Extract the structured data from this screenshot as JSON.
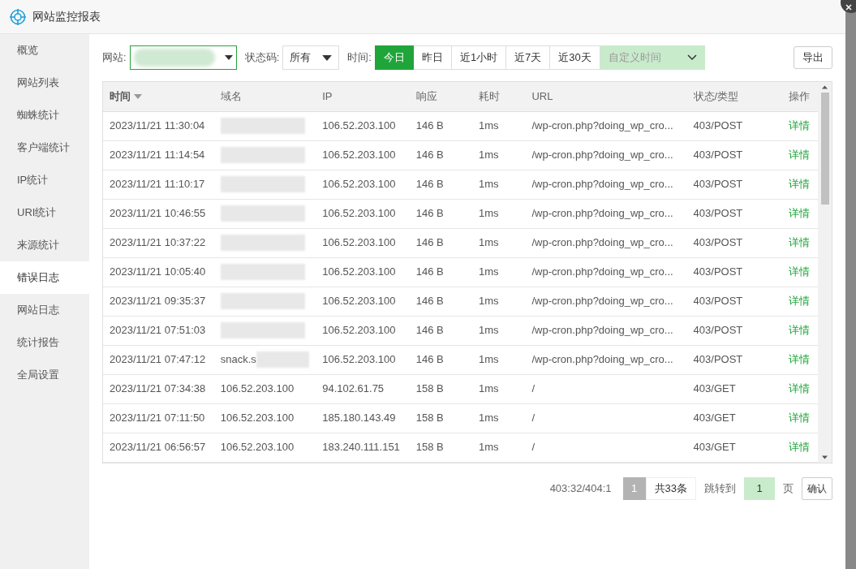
{
  "window": {
    "title": "网站监控报表"
  },
  "sidebar": {
    "items": [
      {
        "label": "概览",
        "selected": false
      },
      {
        "label": "网站列表",
        "selected": false
      },
      {
        "label": "蜘蛛统计",
        "selected": false
      },
      {
        "label": "客户端统计",
        "selected": false
      },
      {
        "label": "IP统计",
        "selected": false
      },
      {
        "label": "URI统计",
        "selected": false
      },
      {
        "label": "来源统计",
        "selected": false
      },
      {
        "label": "错误日志",
        "selected": true
      },
      {
        "label": "网站日志",
        "selected": false
      },
      {
        "label": "统计报告",
        "selected": false
      },
      {
        "label": "全局设置",
        "selected": false
      }
    ]
  },
  "filters": {
    "site_label": "网站:",
    "status_label": "状态码:",
    "status_value": "所有",
    "time_label": "时间:",
    "time_ranges": [
      {
        "label": "今日",
        "selected": true
      },
      {
        "label": "昨日",
        "selected": false
      },
      {
        "label": "近1小时",
        "selected": false
      },
      {
        "label": "近7天",
        "selected": false
      },
      {
        "label": "近30天",
        "selected": false
      }
    ],
    "custom_time_placeholder": "自定义时间",
    "export": "导出"
  },
  "table": {
    "columns": [
      "时间",
      "域名",
      "IP",
      "响应",
      "耗时",
      "URL",
      "状态/类型",
      "操作"
    ],
    "rows": [
      {
        "time": "2023/11/21 11:30:04",
        "domain": "",
        "ip": "106.52.203.100",
        "size": "146 B",
        "duration": "1ms",
        "url": "/wp-cron.php?doing_wp_cro...",
        "status": "403/POST",
        "action": "详情"
      },
      {
        "time": "2023/11/21 11:14:54",
        "domain": "",
        "ip": "106.52.203.100",
        "size": "146 B",
        "duration": "1ms",
        "url": "/wp-cron.php?doing_wp_cro...",
        "status": "403/POST",
        "action": "详情"
      },
      {
        "time": "2023/11/21 11:10:17",
        "domain": "",
        "ip": "106.52.203.100",
        "size": "146 B",
        "duration": "1ms",
        "url": "/wp-cron.php?doing_wp_cro...",
        "status": "403/POST",
        "action": "详情"
      },
      {
        "time": "2023/11/21 10:46:55",
        "domain": "",
        "ip": "106.52.203.100",
        "size": "146 B",
        "duration": "1ms",
        "url": "/wp-cron.php?doing_wp_cro...",
        "status": "403/POST",
        "action": "详情"
      },
      {
        "time": "2023/11/21 10:37:22",
        "domain": "",
        "ip": "106.52.203.100",
        "size": "146 B",
        "duration": "1ms",
        "url": "/wp-cron.php?doing_wp_cro...",
        "status": "403/POST",
        "action": "详情"
      },
      {
        "time": "2023/11/21 10:05:40",
        "domain": "",
        "ip": "106.52.203.100",
        "size": "146 B",
        "duration": "1ms",
        "url": "/wp-cron.php?doing_wp_cro...",
        "status": "403/POST",
        "action": "详情"
      },
      {
        "time": "2023/11/21 09:35:37",
        "domain": "",
        "ip": "106.52.203.100",
        "size": "146 B",
        "duration": "1ms",
        "url": "/wp-cron.php?doing_wp_cro...",
        "status": "403/POST",
        "action": "详情"
      },
      {
        "time": "2023/11/21 07:51:03",
        "domain": "",
        "ip": "106.52.203.100",
        "size": "146 B",
        "duration": "1ms",
        "url": "/wp-cron.php?doing_wp_cro...",
        "status": "403/POST",
        "action": "详情"
      },
      {
        "time": "2023/11/21 07:47:12",
        "domain": "snack.s",
        "ip": "106.52.203.100",
        "size": "146 B",
        "duration": "1ms",
        "url": "/wp-cron.php?doing_wp_cro...",
        "status": "403/POST",
        "action": "详情"
      },
      {
        "time": "2023/11/21 07:34:38",
        "domain": "106.52.203.100",
        "ip": "94.102.61.75",
        "size": "158 B",
        "duration": "1ms",
        "url": "/",
        "status": "403/GET",
        "action": "详情"
      },
      {
        "time": "2023/11/21 07:11:50",
        "domain": "106.52.203.100",
        "ip": "185.180.143.49",
        "size": "158 B",
        "duration": "1ms",
        "url": "/",
        "status": "403/GET",
        "action": "详情"
      },
      {
        "time": "2023/11/21 06:56:57",
        "domain": "106.52.203.100",
        "ip": "183.240.111.151",
        "size": "158 B",
        "duration": "1ms",
        "url": "/",
        "status": "403/GET",
        "action": "详情"
      }
    ]
  },
  "pagination": {
    "summary": "403:32/404:1",
    "current_page": "1",
    "total": "共33条",
    "jump_label": "跳转到",
    "jump_value": "1",
    "page_unit": "页",
    "confirm": "确认"
  }
}
